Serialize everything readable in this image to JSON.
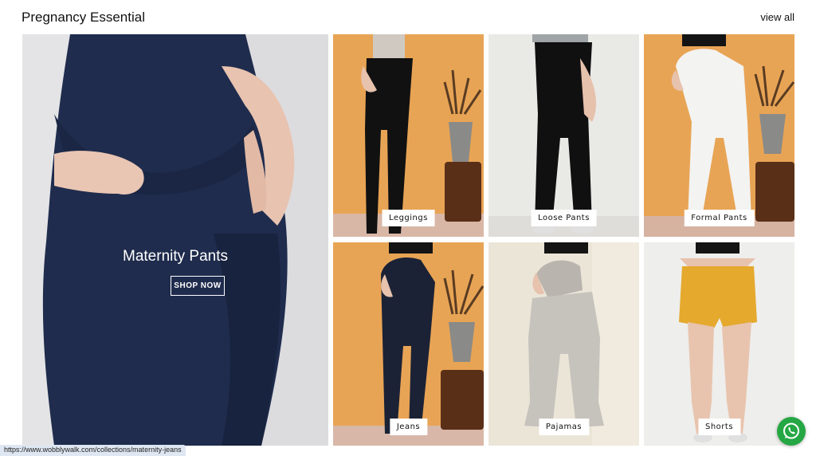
{
  "section": {
    "title": "Pregnancy Essential",
    "view_all": "view all"
  },
  "hero": {
    "title": "Maternity Pants",
    "cta": "SHOP NOW"
  },
  "categories": [
    {
      "label": "Leggings"
    },
    {
      "label": "Loose Pants"
    },
    {
      "label": "Formal Pants"
    },
    {
      "label": "Jeans"
    },
    {
      "label": "Pajamas"
    },
    {
      "label": "Shorts"
    }
  ],
  "status_bar": {
    "url": "https://www.wobblywalk.com/collections/maternity-jeans"
  },
  "icons": {
    "chat": "whatsapp-icon"
  },
  "colors": {
    "orange_bg": "#e9a253",
    "light_bg": "#e7e6e2",
    "navy": "#1d2c4c",
    "whatsapp": "#25a744"
  }
}
